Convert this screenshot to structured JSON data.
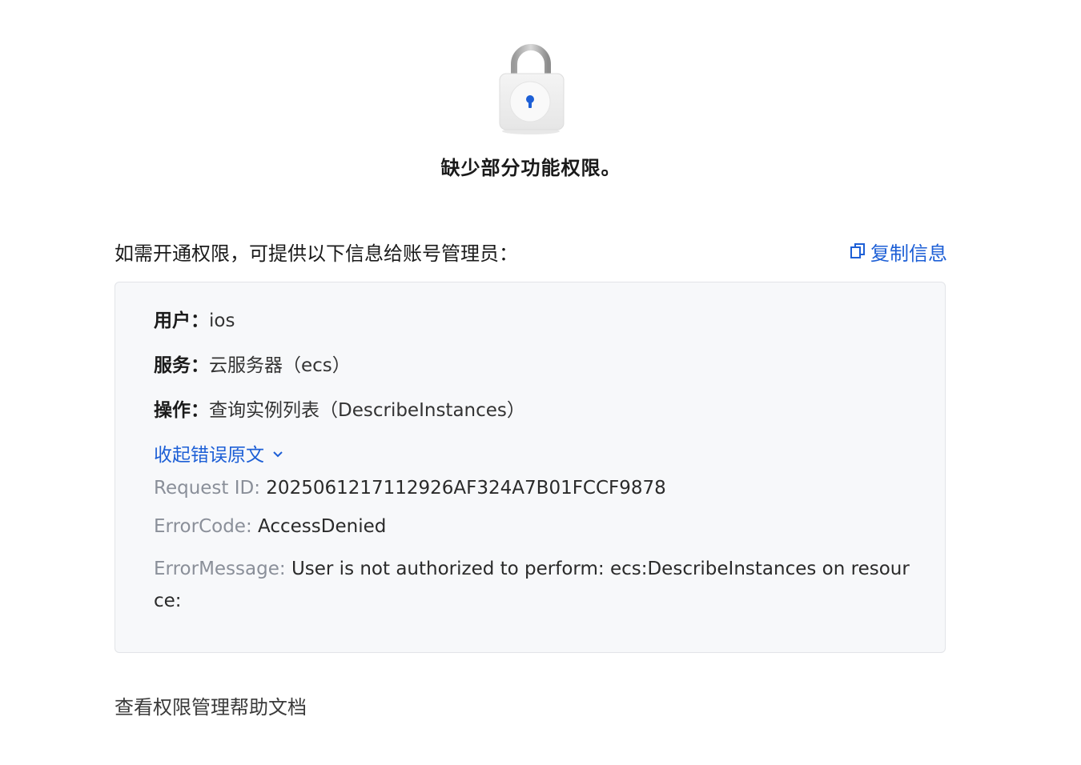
{
  "header": {
    "icon": "lock-icon",
    "title": "缺少部分功能权限。"
  },
  "intro": {
    "text": "如需开通权限，可提供以下信息给账号管理员：",
    "copy_icon": "copy-icon",
    "copy_label": "复制信息"
  },
  "details": {
    "user_key": "用户：",
    "user_value": "ios",
    "service_key": "服务：",
    "service_value": "云服务器（ecs）",
    "action_key": "操作：",
    "action_value": "查询实例列表（DescribeInstances）"
  },
  "error": {
    "toggle_label": "收起错误原文",
    "toggle_icon": "chevron-down-icon",
    "request_id_key": "Request ID: ",
    "request_id_value": "2025061217112926AF324A7B01FCCF9878",
    "code_key": "ErrorCode: ",
    "code_value": "AccessDenied",
    "message_key": "ErrorMessage: ",
    "message_value": "User is not authorized to perform: ecs:DescribeInstances on resource:"
  },
  "footer": {
    "help_link": "查看权限管理帮助文档"
  },
  "colors": {
    "accent": "#1d5fd6",
    "box_bg": "#f7f8fa",
    "box_border": "#e2e4e8",
    "muted_key": "#8a8f99"
  }
}
